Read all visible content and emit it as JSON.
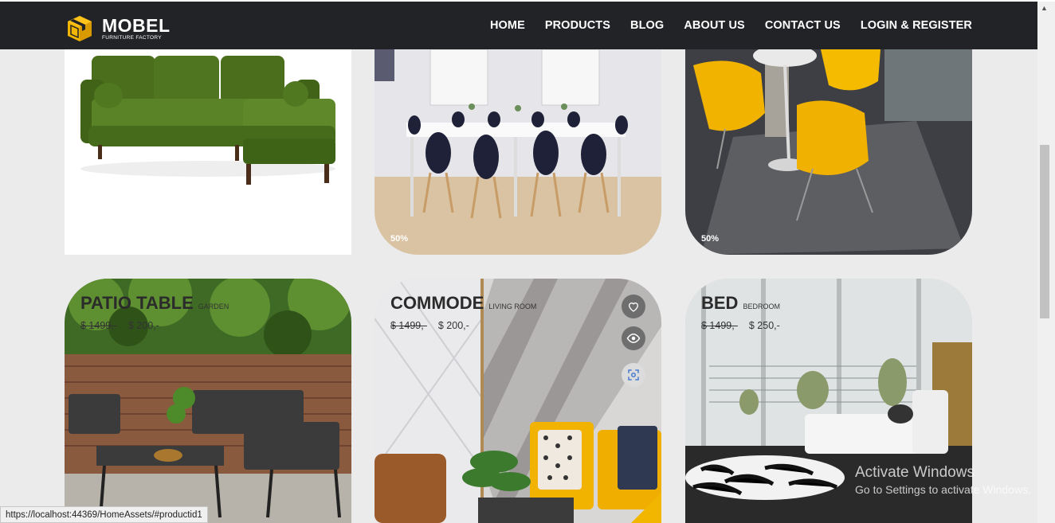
{
  "brand": {
    "name": "MOBEL",
    "tagline": "FURNITURE FACTORY"
  },
  "nav": {
    "items": [
      {
        "label": "HOME"
      },
      {
        "label": "PRODUCTS"
      },
      {
        "label": "BLOG"
      },
      {
        "label": "ABOUT US"
      },
      {
        "label": "CONTACT US"
      },
      {
        "label": "LOGIN & REGISTER"
      }
    ]
  },
  "row1": {
    "dining": {
      "discount": "50%"
    },
    "chairs": {
      "discount": "50%"
    }
  },
  "products": [
    {
      "title": "PATIO TABLE",
      "category": "GARDEN",
      "old_price": "$ 1499,-",
      "price": "$ 200,-"
    },
    {
      "title": "COMMODE",
      "category": "LIVING ROOM",
      "old_price": "$ 1499,-",
      "price": "$ 200,-"
    },
    {
      "title": "BED",
      "category": "BEDROOM",
      "old_price": "$ 1499,-",
      "price": "$ 250,-"
    }
  ],
  "icons": {
    "wishlist": "heart-icon",
    "quick_view": "eye-icon",
    "compare": "focus-icon"
  },
  "status_bar": {
    "url": "https://localhost:44369/HomeAssets/#productid1"
  },
  "windows_watermark": {
    "line1": "Activate Windows",
    "line2": "Go to Settings to activate Windows."
  },
  "colors": {
    "navbar": "#222326",
    "accent": "#f2b600",
    "background": "#ebebeb"
  }
}
